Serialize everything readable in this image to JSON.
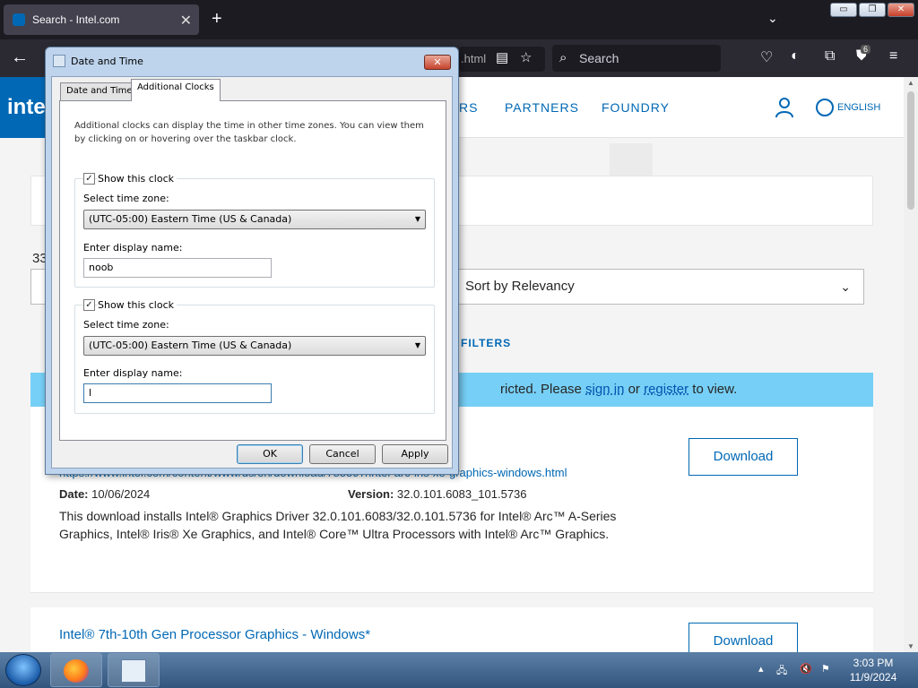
{
  "browser": {
    "tab_title": "Search - Intel.com",
    "tab_close": "✕",
    "new_tab": "+",
    "url_fragment": ".html",
    "search_placeholder": "Search",
    "extension_badge": "6"
  },
  "site": {
    "logo_text": "intel",
    "nav": [
      "RS",
      "PARTNERS",
      "FOUNDRY"
    ],
    "language": "ENGLISH",
    "results_count_fragment": "33",
    "sort_label": "Sort by Relevancy",
    "filters_label": "FILTERS",
    "notice": {
      "prefix": "ricted. Please ",
      "sign_in": "sign in",
      "middle": " or ",
      "register": "register",
      "suffix": " to view."
    },
    "result1": {
      "url": "https://www.intel.com/content/www/us/en/download/785597/intel-arc-iris-xe-graphics-windows.html",
      "date_label": "Date:",
      "date_value": "10/06/2024",
      "version_label": "Version:",
      "version_value": "32.0.101.6083_101.5736",
      "description": "This download installs Intel® Graphics Driver 32.0.101.6083/32.0.101.5736 for Intel® Arc™ A-Series Graphics, Intel® Iris® Xe Graphics, and Intel® Core™ Ultra Processors with Intel® Arc™ Graphics.",
      "download": "Download"
    },
    "result2": {
      "title": "Intel® 7th-10th Gen Processor Graphics - Windows*",
      "download": "Download"
    }
  },
  "dialog": {
    "title": "Date and Time",
    "close_glyph": "✕",
    "tabs": [
      "Date and Time",
      "Additional Clocks"
    ],
    "intro": "Additional clocks can display the time in other time zones. You can view them by clicking on or hovering over the taskbar clock.",
    "clocks": [
      {
        "show_label": "Show this clock",
        "checked": true,
        "tz_label": "Select time zone:",
        "tz_value": "(UTC-05:00) Eastern Time (US & Canada)",
        "name_label": "Enter display name:",
        "name_value": "noob"
      },
      {
        "show_label": "Show this clock",
        "checked": true,
        "tz_label": "Select time zone:",
        "tz_value": "(UTC-05:00) Eastern Time (US & Canada)",
        "name_label": "Enter display name:",
        "name_value": "l"
      }
    ],
    "buttons": {
      "ok": "OK",
      "cancel": "Cancel",
      "apply": "Apply"
    }
  },
  "taskbar": {
    "time": "3:03 PM",
    "date": "11/9/2024"
  }
}
